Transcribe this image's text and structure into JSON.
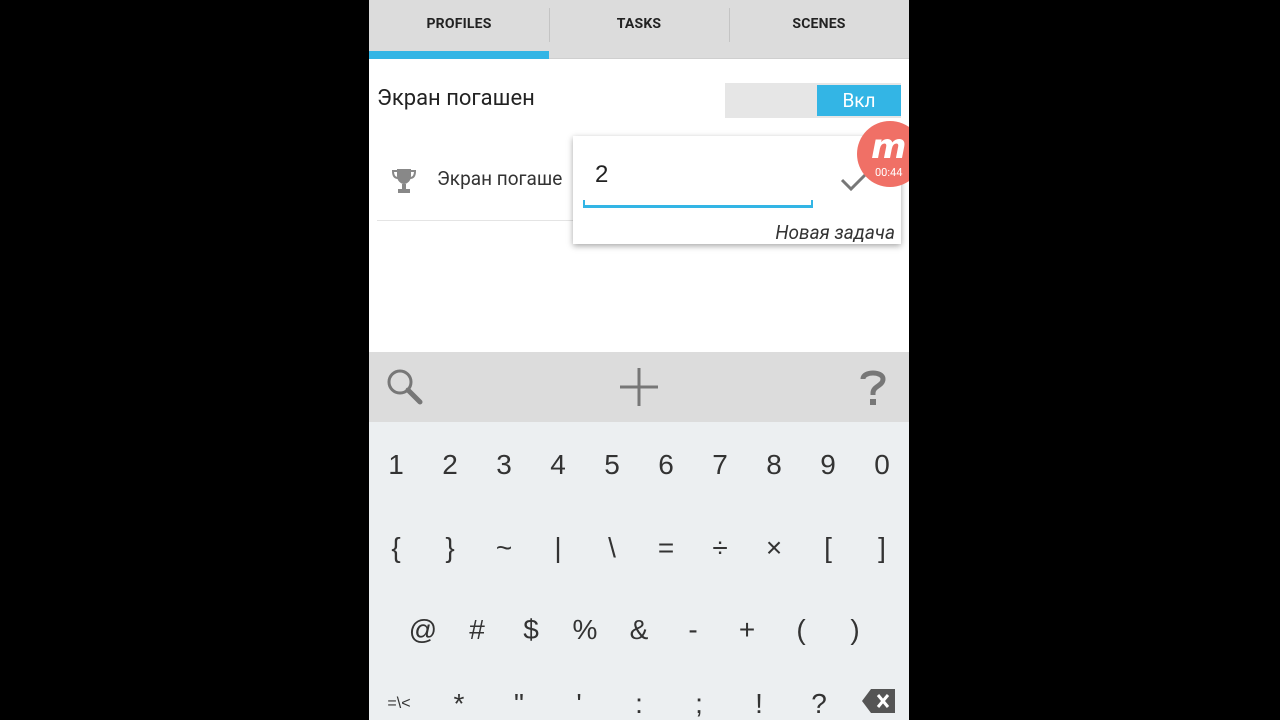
{
  "tabs": [
    {
      "label": "PROFILES",
      "active": true
    },
    {
      "label": "TASKS",
      "active": false
    },
    {
      "label": "SCENES",
      "active": false
    }
  ],
  "profile": {
    "title": "Экран погашен",
    "toggle_label": "Вкл",
    "context_label": "Экран погаше"
  },
  "popup": {
    "input_value": "2",
    "hint": "Новая задача"
  },
  "recorder": {
    "logo_letter": "m",
    "time": "00:44"
  },
  "toolbar": {
    "icons": [
      "search-icon",
      "add-icon",
      "help-icon"
    ]
  },
  "keyboard": {
    "row1": [
      "1",
      "2",
      "3",
      "4",
      "5",
      "6",
      "7",
      "8",
      "9",
      "0"
    ],
    "row2": [
      "{",
      "}",
      "~",
      "|",
      "\\",
      "=",
      "÷",
      "×",
      "[",
      "]"
    ],
    "row3": [
      "@",
      "#",
      "$",
      "%",
      "&",
      "-",
      "+",
      "(",
      ")"
    ],
    "row4": [
      "=\\<",
      "*",
      "\"",
      "'",
      ":",
      ";",
      "!",
      "?"
    ]
  },
  "colors": {
    "accent": "#33b5e5",
    "recorder": "#f07066"
  }
}
